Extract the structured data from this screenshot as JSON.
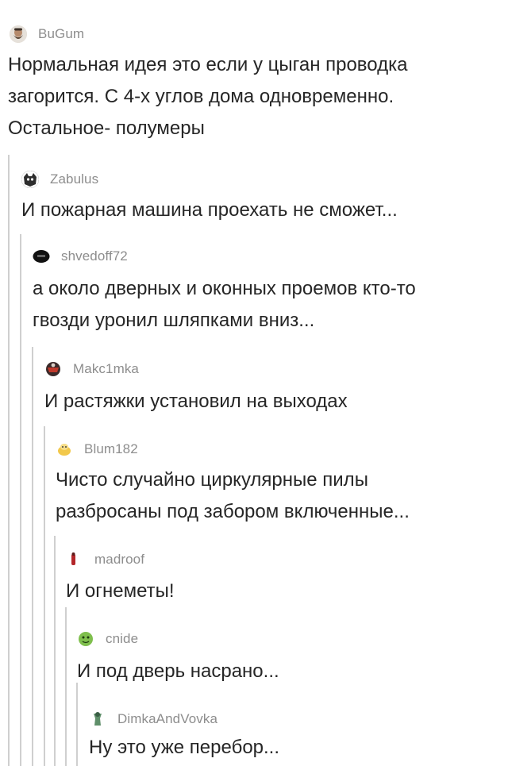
{
  "comments": [
    {
      "username": "BuGum",
      "avatar_icon": "bearded-man-avatar-icon",
      "text": "Нормальная идея это если у цыган проводка\nзагорится. С 4-х углов дома одновременно.\nОстальное- полумеры"
    },
    {
      "username": "Zabulus",
      "avatar_icon": "dark-creature-avatar-icon",
      "text": "И пожарная машина проехать не сможет..."
    },
    {
      "username": "shvedoff72",
      "avatar_icon": "black-oval-avatar-icon",
      "text": "а около дверных и оконных проемов кто-то\nгвозди уронил шляпками вниз..."
    },
    {
      "username": "Makc1mka",
      "avatar_icon": "red-dark-avatar-icon",
      "text": "И растяжки установил на выходах"
    },
    {
      "username": "Blum182",
      "avatar_icon": "yellow-creature-avatar-icon",
      "text": "Чисто случайно циркулярные пилы\nразбросаны под забором включенные..."
    },
    {
      "username": "madroof",
      "avatar_icon": "red-figure-avatar-icon",
      "text": "И огнеметы!"
    },
    {
      "username": "cnide",
      "avatar_icon": "green-face-avatar-icon",
      "text": "И под дверь насрано..."
    },
    {
      "username": "DimkaAndVovka",
      "avatar_icon": "green-character-avatar-icon",
      "text": "Ну это уже перебор..."
    }
  ]
}
